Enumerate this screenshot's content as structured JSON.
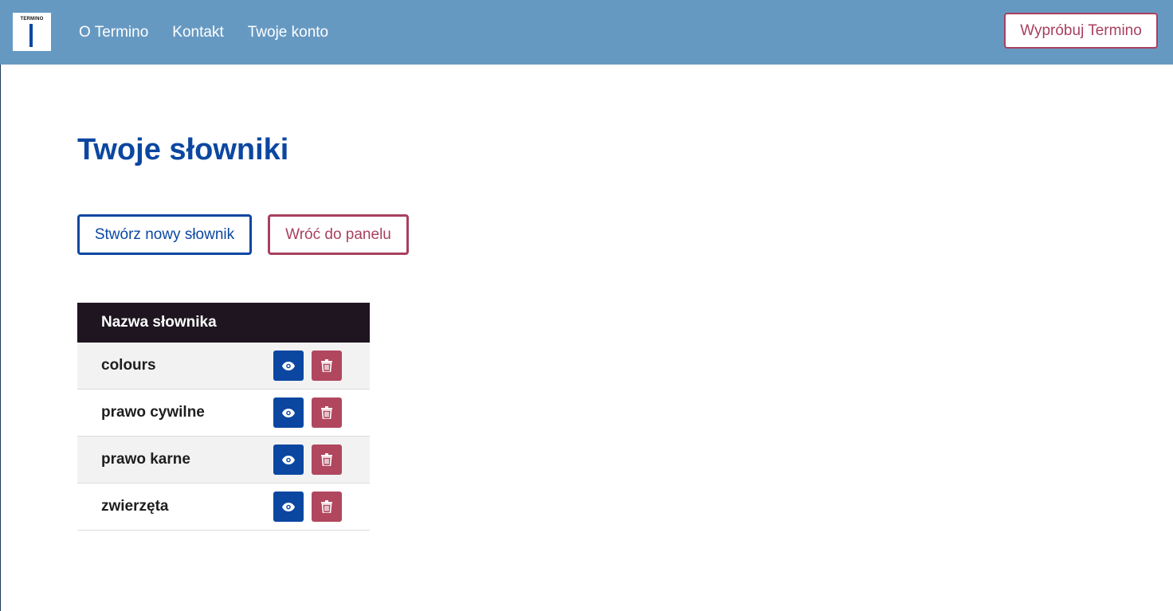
{
  "navbar": {
    "logo_text": "TERMINO",
    "links": [
      "O Termino",
      "Kontakt",
      "Twoje konto"
    ],
    "try_button": "Wypróbuj Termino"
  },
  "main": {
    "title": "Twoje słowniki",
    "create_button": "Stwórz nowy słownik",
    "back_button": "Wróć do panelu"
  },
  "table": {
    "header": "Nazwa słownika",
    "rows": [
      {
        "name": "colours",
        "view_icon": "eye-icon",
        "delete_icon": "trash-icon"
      },
      {
        "name": "prawo cywilne",
        "view_icon": "eye-icon",
        "delete_icon": "trash-icon"
      },
      {
        "name": "prawo karne",
        "view_icon": "eye-icon",
        "delete_icon": "trash-icon"
      },
      {
        "name": "zwierzęta",
        "view_icon": "eye-icon",
        "delete_icon": "trash-icon"
      }
    ]
  },
  "colors": {
    "navbar": "#6699c2",
    "primary": "#0b47a1",
    "secondary": "#a8405f",
    "table_header": "#1e1520"
  }
}
